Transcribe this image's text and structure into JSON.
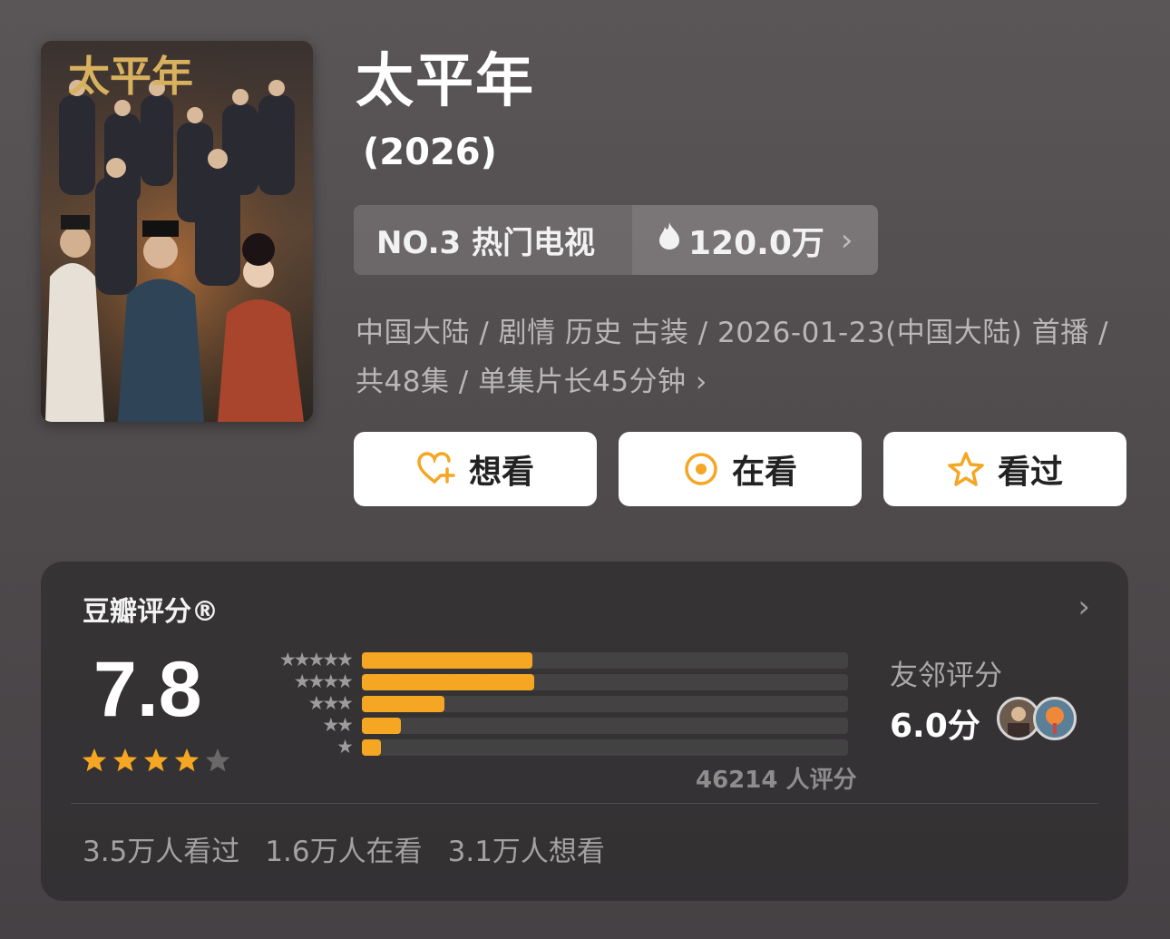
{
  "title": "太平年",
  "year": "(2026)",
  "poster": {
    "alt": "太平年 poster",
    "calligraphy": "太平年"
  },
  "rank": {
    "label": "NO.3 热门电视",
    "heat": "120.0万",
    "heat_icon": "flame-icon",
    "chevron": "›"
  },
  "meta": {
    "line1": "中国大陆 / 剧情 历史 古装 / 2026-01-23(中国大陆) 首播 /",
    "line2": "共48集 / 单集片长45分钟",
    "chevron": "›"
  },
  "actions": [
    {
      "label": "想看",
      "icon": "heart-plus-icon"
    },
    {
      "label": "在看",
      "icon": "target-icon"
    },
    {
      "label": "看过",
      "icon": "star-outline-icon"
    }
  ],
  "rating": {
    "card_title": "豆瓣评分®",
    "chevron": "›",
    "score": "7.8",
    "stars_full": 4,
    "stars_total": 5,
    "distribution": [
      {
        "stars": 5,
        "fraction": 0.35
      },
      {
        "stars": 4,
        "fraction": 0.355
      },
      {
        "stars": 3,
        "fraction": 0.17
      },
      {
        "stars": 2,
        "fraction": 0.08
      },
      {
        "stars": 1,
        "fraction": 0.04
      }
    ],
    "count_text": "46214 人评分",
    "friends_label": "友邻评分",
    "friends_score": "6.0分"
  },
  "stats": {
    "watched": "3.5万人看过",
    "watching": "1.6万人在看",
    "want": "3.1万人想看"
  },
  "colors": {
    "accent": "#f5a623",
    "background": "#504c4e",
    "card": "#2d2b2d"
  }
}
